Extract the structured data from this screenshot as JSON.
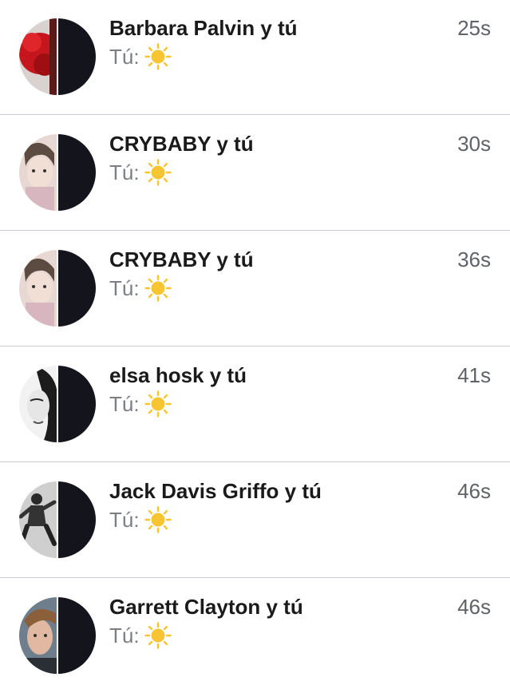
{
  "conversations": [
    {
      "name": "Barbara Palvin y tú",
      "preview_prefix": "Tú:",
      "preview_emoji": "sun-emoji",
      "time": "25s",
      "avatar": "left-photo-red-flowers-right-dark"
    },
    {
      "name": "CRYBABY y tú",
      "preview_prefix": "Tú:",
      "preview_emoji": "sun-emoji",
      "time": "30s",
      "avatar": "left-photo-girl-pastel-right-dark"
    },
    {
      "name": "CRYBABY y tú",
      "preview_prefix": "Tú:",
      "preview_emoji": "sun-emoji",
      "time": "36s",
      "avatar": "left-photo-girl-pastel-right-dark"
    },
    {
      "name": "elsa hosk y tú",
      "preview_prefix": "Tú:",
      "preview_emoji": "sun-emoji",
      "time": "41s",
      "avatar": "left-photo-bw-face-right-dark"
    },
    {
      "name": "Jack Davis Griffo y tú",
      "preview_prefix": "Tú:",
      "preview_emoji": "sun-emoji",
      "time": "46s",
      "avatar": "left-photo-bw-jump-right-dark"
    },
    {
      "name": "Garrett Clayton y tú",
      "preview_prefix": "Tú:",
      "preview_emoji": "sun-emoji",
      "time": "46s",
      "avatar": "left-photo-man-portrait-right-dark"
    }
  ],
  "colors": {
    "name_text": "#1a1a1a",
    "time_text": "#5f6368",
    "preview_text": "#7b7f84",
    "divider": "#c8ccd2",
    "avatar_dark_half": "#13141c",
    "sun_yellow": "#f6c531"
  }
}
